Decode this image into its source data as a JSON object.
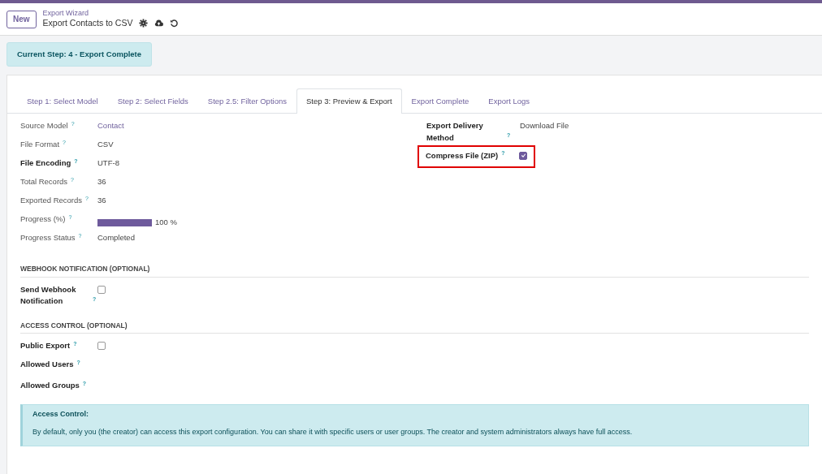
{
  "header": {
    "new_button": "New",
    "breadcrumb": "Export Wizard",
    "record_title": "Export Contacts to CSV"
  },
  "status_badge": "Current Step: 4 - Export Complete",
  "tabs": [
    {
      "label": "Step 1: Select Model",
      "selected": false
    },
    {
      "label": "Step 2: Select Fields",
      "selected": false
    },
    {
      "label": "Step 2.5: Filter Options",
      "selected": false
    },
    {
      "label": "Step 3: Preview & Export",
      "selected": true
    },
    {
      "label": "Export Complete",
      "selected": false
    },
    {
      "label": "Export Logs",
      "selected": false
    }
  ],
  "left_fields": [
    {
      "label": "Source Model",
      "help": "?",
      "strong": false,
      "kind": "link",
      "value": "Contact"
    },
    {
      "label": "File Format",
      "help": "?",
      "strong": false,
      "kind": "text",
      "value": "CSV"
    },
    {
      "label": "File Encoding",
      "help": "?",
      "strong": true,
      "kind": "text",
      "value": "UTF-8"
    },
    {
      "label": "Total Records",
      "help": "?",
      "strong": false,
      "kind": "text",
      "value": "36"
    },
    {
      "label": "Exported Records",
      "help": "?",
      "strong": false,
      "kind": "text",
      "value": "36"
    },
    {
      "label": "Progress (%)",
      "help": "?",
      "strong": false,
      "kind": "progress",
      "level": 1,
      "value": "100 %"
    },
    {
      "label": "Progress Status",
      "help": "?",
      "strong": false,
      "kind": "text",
      "value": "Completed"
    }
  ],
  "right_fields": [
    {
      "label": "Export Delivery Method",
      "help": "?",
      "strong": true,
      "kind": "text",
      "value": "Download File",
      "highlighted": false
    },
    {
      "label": "Compress File (ZIP)",
      "help": "?",
      "strong": true,
      "kind": "checkbox",
      "checked": true,
      "highlighted": true
    }
  ],
  "sections": [
    {
      "title": "WEBHOOK NOTIFICATION (OPTIONAL)",
      "fields": [
        {
          "label": "Send Webhook Notification",
          "help": "?",
          "strong": true,
          "kind": "checkbox",
          "checked": false
        }
      ]
    },
    {
      "title": "ACCESS CONTROL (OPTIONAL)",
      "fields": [
        {
          "label": "Public Export",
          "help": "?",
          "strong": true,
          "kind": "checkbox",
          "checked": false
        },
        {
          "label": "Allowed Users",
          "help": "?",
          "strong": true,
          "kind": "empty"
        },
        {
          "label": "Allowed Groups",
          "help": "?",
          "strong": true,
          "kind": "empty"
        }
      ]
    }
  ],
  "alert": {
    "title": "Access Control:",
    "text": "By default, only you (the creator) can access this export configuration. You can share it with specific users or user groups. The creator and system administrators always have full access."
  }
}
